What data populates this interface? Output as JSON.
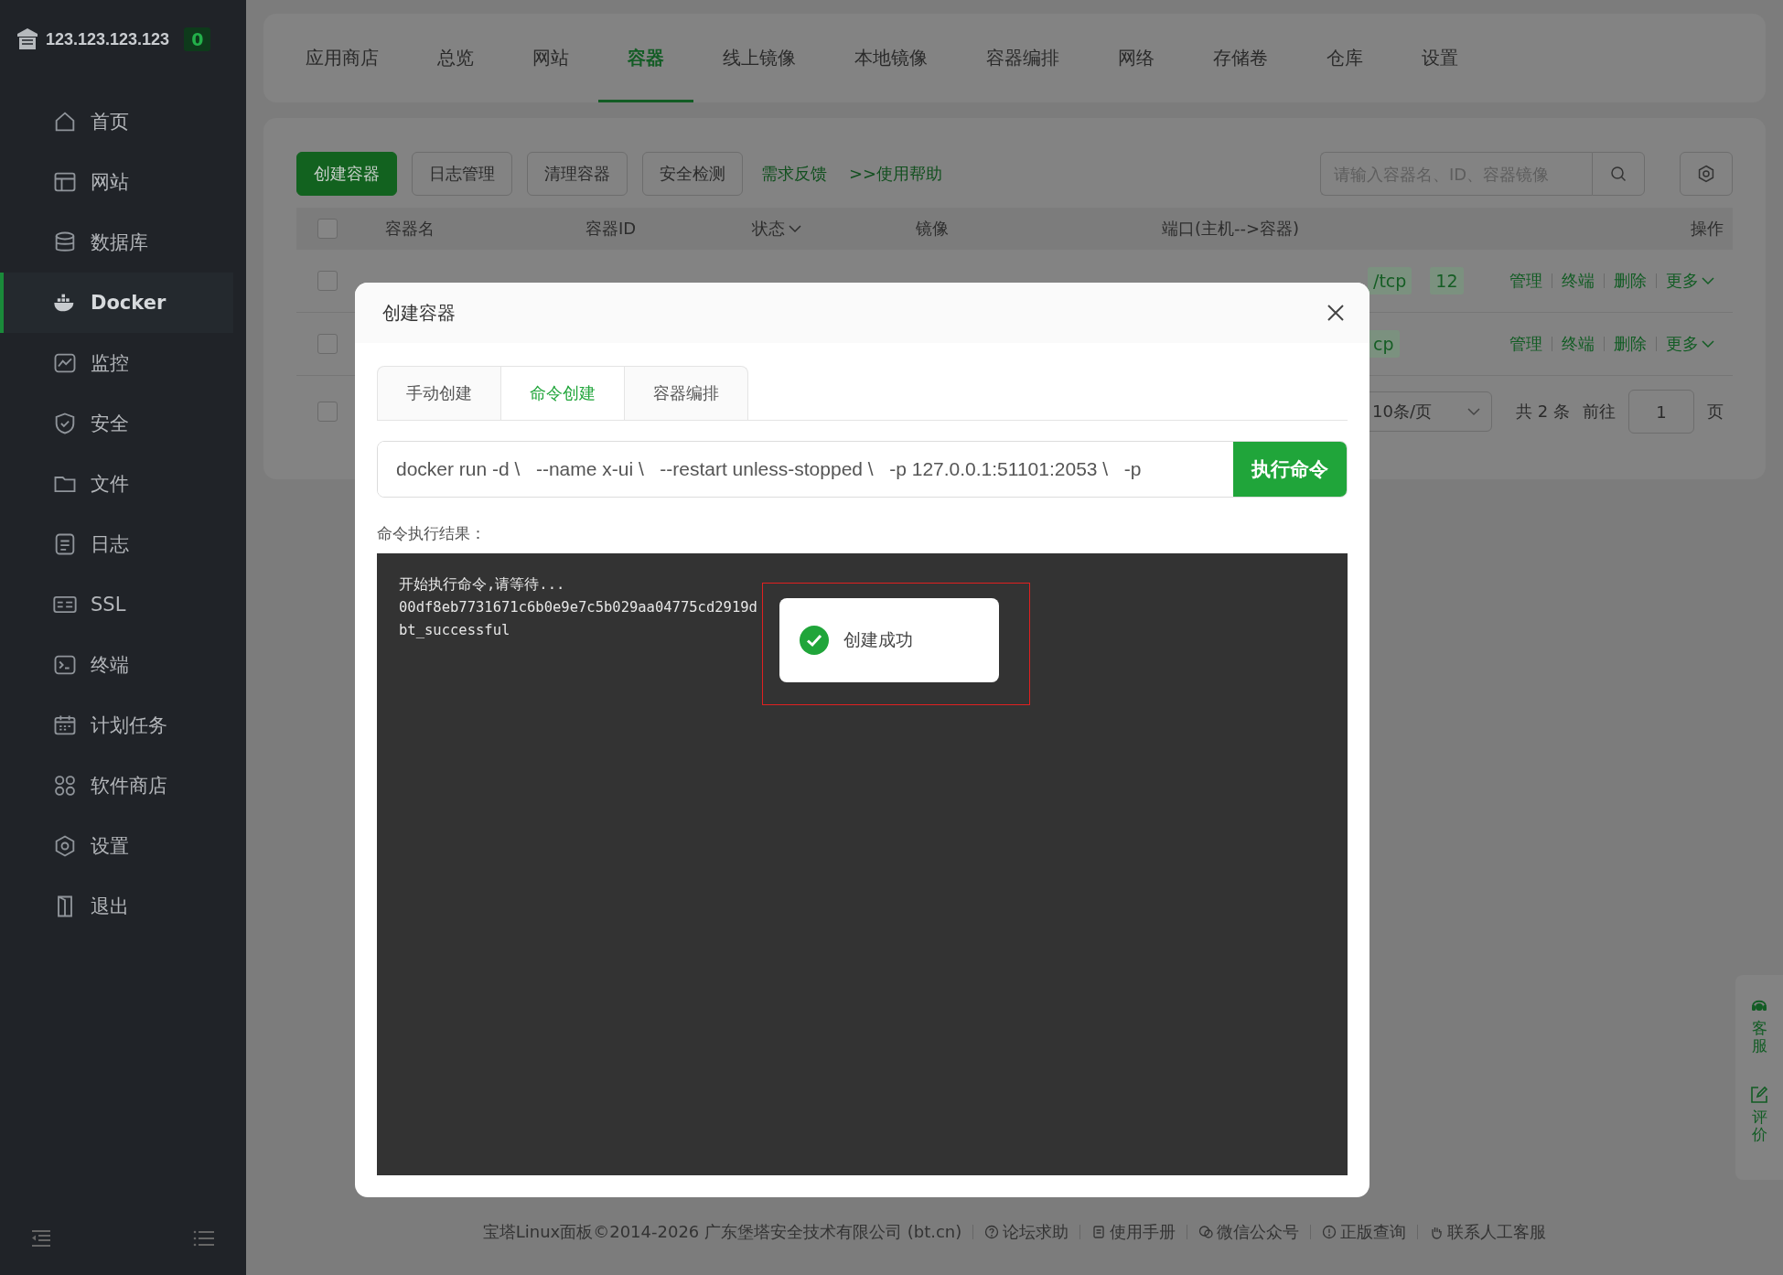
{
  "server": {
    "ip": "123.123.123.123",
    "badge": "0"
  },
  "sidebar": {
    "items": [
      {
        "label": "首页",
        "selected": false
      },
      {
        "label": "网站",
        "selected": false
      },
      {
        "label": "数据库",
        "selected": false
      },
      {
        "label": "Docker",
        "selected": true
      },
      {
        "label": "监控",
        "selected": false
      },
      {
        "label": "安全",
        "selected": false
      },
      {
        "label": "文件",
        "selected": false
      },
      {
        "label": "日志",
        "selected": false
      },
      {
        "label": "SSL",
        "selected": false
      },
      {
        "label": "终端",
        "selected": false
      },
      {
        "label": "计划任务",
        "selected": false
      },
      {
        "label": "软件商店",
        "selected": false
      },
      {
        "label": "设置",
        "selected": false
      },
      {
        "label": "退出",
        "selected": false
      }
    ]
  },
  "top_tabs": [
    {
      "label": "应用商店",
      "selected": false
    },
    {
      "label": "总览",
      "selected": false
    },
    {
      "label": "网站",
      "selected": false
    },
    {
      "label": "容器",
      "selected": true
    },
    {
      "label": "线上镜像",
      "selected": false
    },
    {
      "label": "本地镜像",
      "selected": false
    },
    {
      "label": "容器编排",
      "selected": false
    },
    {
      "label": "网络",
      "selected": false
    },
    {
      "label": "存储卷",
      "selected": false
    },
    {
      "label": "仓库",
      "selected": false
    },
    {
      "label": "设置",
      "selected": false
    }
  ],
  "toolbar": {
    "buttons": [
      {
        "label": "创建容器",
        "kind": "primary"
      },
      {
        "label": "日志管理",
        "kind": "default"
      },
      {
        "label": "清理容器",
        "kind": "default"
      },
      {
        "label": "安全检测",
        "kind": "default"
      },
      {
        "label": "需求反馈",
        "kind": "link"
      },
      {
        "label": ">>使用帮助",
        "kind": "link"
      }
    ],
    "search": {
      "placeholder": "请输入容器名、ID、容器镜像"
    }
  },
  "table": {
    "header_checked": false,
    "columns": [
      {
        "label": "容器名",
        "kind": "plain"
      },
      {
        "label": "容器ID",
        "kind": "plain"
      },
      {
        "label": "状态",
        "kind": "dropdown"
      },
      {
        "label": "镜像",
        "kind": "plain"
      },
      {
        "label": "端口(主机-->容器)",
        "kind": "plain"
      },
      {
        "label": "操作",
        "kind": "plain"
      }
    ],
    "rows": [
      {
        "checked": false,
        "ports": [
          "/tcp",
          "12"
        ],
        "actions": [
          {
            "label": "管理",
            "kind": "plain"
          },
          {
            "label": "终端",
            "kind": "plain"
          },
          {
            "label": "删除",
            "kind": "plain"
          },
          {
            "label": "更多",
            "kind": "dropdown"
          }
        ]
      },
      {
        "checked": false,
        "ports": [
          "cp"
        ],
        "actions": [
          {
            "label": "管理",
            "kind": "plain"
          },
          {
            "label": "终端",
            "kind": "plain"
          },
          {
            "label": "删除",
            "kind": "plain"
          },
          {
            "label": "更多",
            "kind": "dropdown"
          }
        ]
      }
    ]
  },
  "pagination": {
    "checked": false,
    "page_size": "10条/页",
    "total": "共 2 条",
    "goto": "前往",
    "page": "1",
    "suffix": "页"
  },
  "dialog": {
    "title": "创建容器",
    "tabs": [
      {
        "label": "手动创建",
        "selected": false
      },
      {
        "label": "命令创建",
        "selected": true
      },
      {
        "label": "容器编排",
        "selected": false
      }
    ],
    "command": "docker run -d \\   --name x-ui \\   --restart unless-stopped \\   -p 127.0.0.1:51101:2053 \\   -p",
    "run_button": "执行命令",
    "result_label": "命令执行结果：",
    "output": [
      "开始执行命令,请等待...",
      "00df8eb7731671c6b0e9e7c5b029aa04775cd2919d",
      "bt_successful"
    ],
    "toast": {
      "message": "创建成功",
      "highlighted": true
    }
  },
  "float_widget": {
    "items": [
      "客服",
      "评价"
    ]
  },
  "footer": {
    "copyright": "宝塔Linux面板©2014-2026 广东堡塔安全技术有限公司 (bt.cn)",
    "links": [
      "论坛求助",
      "使用手册",
      "微信公众号",
      "正版查询",
      "联系人工客服"
    ]
  }
}
